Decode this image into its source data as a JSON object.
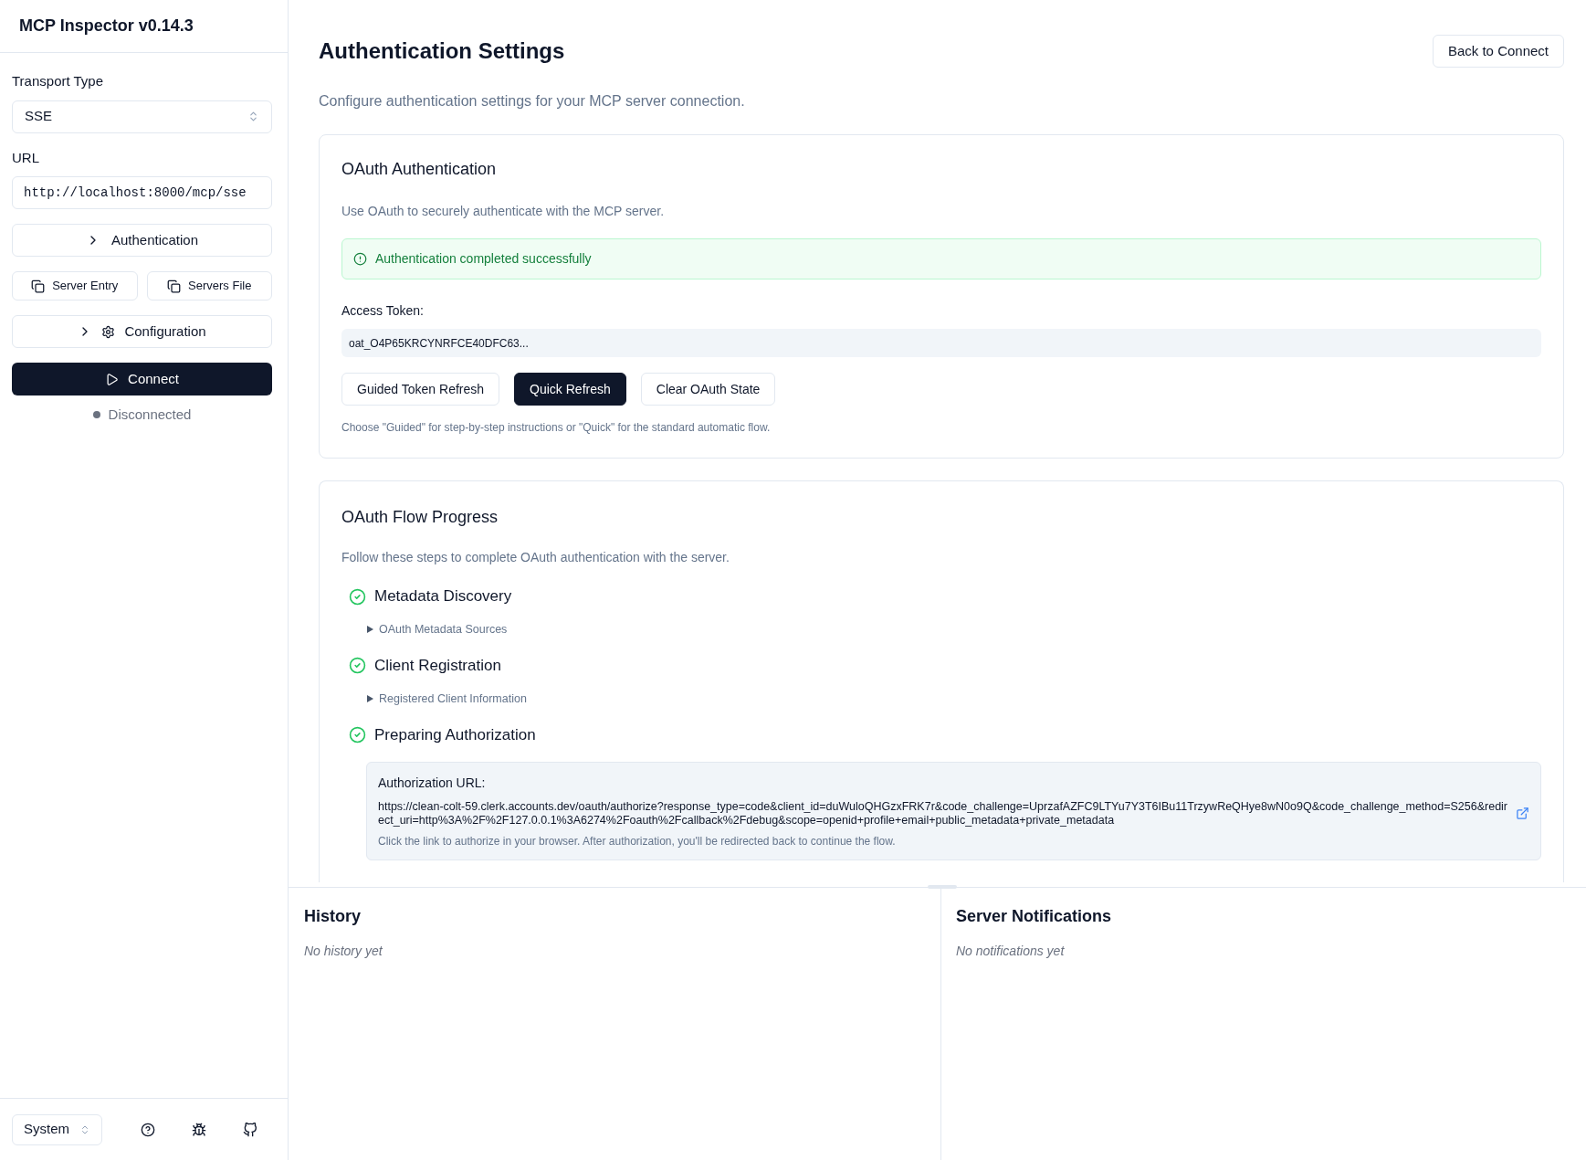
{
  "sidebar": {
    "title": "MCP Inspector v0.14.3",
    "transport": {
      "label": "Transport Type",
      "value": "SSE"
    },
    "url": {
      "label": "URL",
      "value": "http://localhost:8000/mcp/sse"
    },
    "authentication": {
      "label": "Authentication",
      "expanded": false
    },
    "copy_buttons": [
      "Server Entry",
      "Servers File"
    ],
    "configuration": {
      "label": "Configuration",
      "expanded": false
    },
    "connect_button": "Connect",
    "status": {
      "label": "Disconnected",
      "connected": false
    },
    "theme_select": "System"
  },
  "header": {
    "title": "Authentication Settings",
    "back_button": "Back to Connect",
    "description": "Configure authentication settings for your MCP server connection."
  },
  "oauth_card": {
    "title": "OAuth Authentication",
    "description": "Use OAuth to securely authenticate with the MCP server.",
    "alert": "Authentication completed successfully",
    "token_label": "Access Token:",
    "token": "oat_O4P65KRCYNRFCE40DFC63...",
    "buttons": [
      {
        "label": "Guided Token Refresh",
        "kind": "outline"
      },
      {
        "label": "Quick Refresh",
        "kind": "primary"
      },
      {
        "label": "Clear OAuth State",
        "kind": "outline"
      }
    ],
    "hint": "Choose \"Guided\" for step-by-step instructions or \"Quick\" for the standard automatic flow."
  },
  "flow_card": {
    "title": "OAuth Flow Progress",
    "description": "Follow these steps to complete OAuth authentication with the server.",
    "steps": [
      {
        "title": "Metadata Discovery",
        "complete": true,
        "details": {
          "label": "OAuth Metadata Sources",
          "expanded": false
        }
      },
      {
        "title": "Client Registration",
        "complete": true,
        "details": {
          "label": "Registered Client Information",
          "expanded": false
        }
      },
      {
        "title": "Preparing Authorization",
        "complete": true,
        "auth_url": {
          "label": "Authorization URL:",
          "url": "https://clean-colt-59.clerk.accounts.dev/oauth/authorize?response_type=code&client_id=duWuloQHGzxFRK7r&code_challenge=UprzafAZFC9LTYu7Y3T6IBu11TrzywReQHye8wN0o9Q&code_challenge_method=S256&redirect_uri=http%3A%2F%2F127.0.0.1%3A6274%2Foauth%2Fcallback%2Fdebug&scope=openid+profile+email+public_metadata+private_metadata",
          "hint": "Click the link to authorize in your browser. After authorization, you'll be redirected back to continue the flow."
        }
      }
    ]
  },
  "history": {
    "title": "History",
    "empty": "No history yet"
  },
  "notifications": {
    "title": "Server Notifications",
    "empty": "No notifications yet"
  }
}
